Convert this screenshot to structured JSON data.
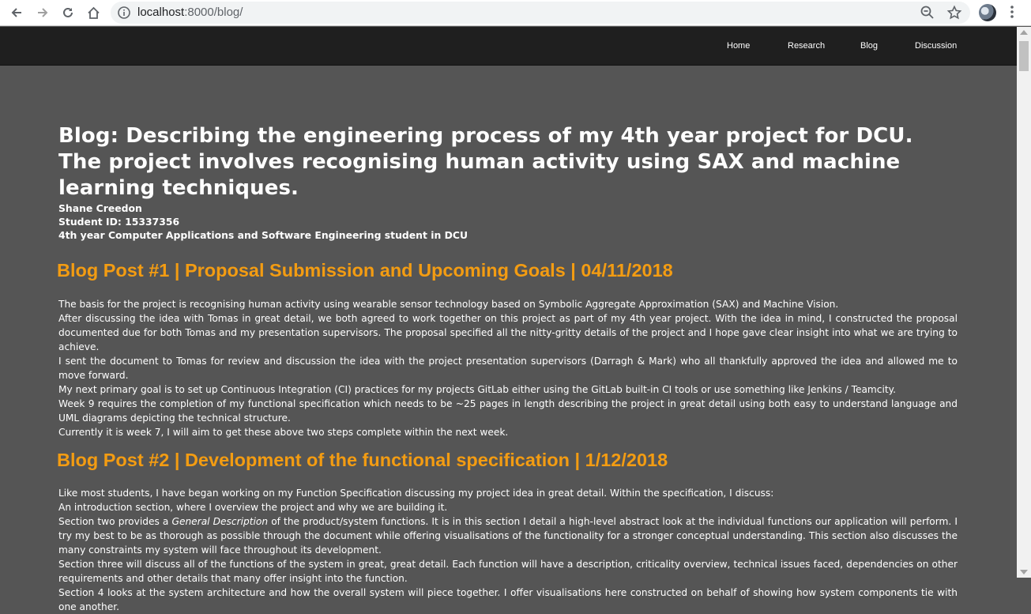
{
  "browser": {
    "url_host": "localhost",
    "url_path": ":8000/blog/"
  },
  "nav": {
    "items": [
      "Home",
      "Research",
      "Blog",
      "Discussion"
    ]
  },
  "header": {
    "title_line1": "Blog: Describing the engineering process of my 4th year project for DCU.",
    "title_line2": "The project involves recognising human activity using SAX and machine learning techniques.",
    "author_name": "Shane Creedon",
    "student_id": "Student ID: 15337356",
    "description": "4th year Computer Applications and Software Engineering student in DCU"
  },
  "posts": [
    {
      "title": "Blog Post #1 | Proposal Submission and Upcoming Goals | 04/11/2018",
      "paragraphs": [
        "The basis for the project is recognising human activity using wearable sensor technology based on Symbolic Aggregate Approximation (SAX) and Machine Vision.",
        "After discussing the idea with Tomas in great detail, we both agreed to work together on this project as part of my 4th year project. With the idea in mind, I constructed the proposal documented due for both Tomas and my presentation supervisors. The proposal specified all the nitty-gritty details of the project and I hope gave clear insight into what we are trying to achieve.",
        "I sent the document to Tomas for review and discussion the idea with the project presentation supervisors (Darragh & Mark) who all thankfully approved the idea and allowed me to move forward.",
        "My next primary goal is to set up Continuous Integration (CI) practices for my projects GitLab either using the GitLab built-in CI tools or use something like Jenkins / Teamcity.",
        "Week 9 requires the completion of my functional specification which needs to be ~25 pages in length describing the project in great detail using both easy to understand language and UML diagrams depicting the technical structure.",
        "Currently it is week 7, I will aim to get these above two steps complete within the next week."
      ]
    },
    {
      "title": "Blog Post #2 | Development of the functional specification | 1/12/2018",
      "paragraphs": [
        "Like most students, I have began working on my Function Specification discussing my project idea in great detail. Within the specification, I discuss:",
        "An introduction section, where I overview the project and why we are building it."
      ],
      "section_two_pre": "Section two provides a ",
      "section_two_em": "General Description",
      "section_two_post": " of the product/system functions. It is in this section I detail a high-level abstract look at the individual functions our application will perform. I try my best to be as thorough as possible through the document while offering visualisations of the functionality for a stronger conceptual understanding. This section also discusses the many constraints my system will face throughout its development.",
      "paragraphs_after": [
        "Section three will discuss all of the functions of the system in great, great detail. Each function will have a description, criticality overview, technical issues faced, dependencies on other requirements and other details that many offer insight into the function.",
        "Section 4 looks at the system architecture and how the overall system will piece together. I offer visualisations here constructed on behalf of showing how system components tie with one another."
      ]
    }
  ]
}
